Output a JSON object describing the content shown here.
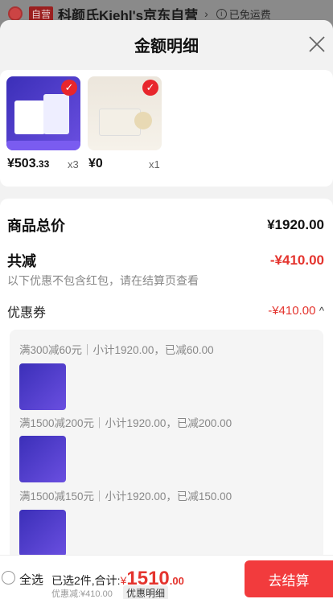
{
  "background_header": {
    "tag": "自营",
    "store_name": "科颜氏Kiehl's京东自营",
    "arrow": "›",
    "shipping": "已免运费",
    "info_icon": "i"
  },
  "sheet": {
    "title": "金额明细",
    "close_icon": "close-icon"
  },
  "products": [
    {
      "price_main": "¥503",
      "price_dec": ".33",
      "qty": "x3"
    },
    {
      "price_main": "¥0",
      "price_dec": "",
      "qty": "x1"
    }
  ],
  "summary": {
    "goods_total_label": "商品总价",
    "goods_total_value": "¥1920.00",
    "reduction_label": "共减",
    "reduction_value": "-¥410.00",
    "note": "以下优惠不包含红包，请在结算页查看",
    "coupon_label": "优惠券",
    "coupon_value": "-¥410.00",
    "coupon_toggle": "^"
  },
  "coupons": [
    {
      "line": "满300减60元｜小计1920.00，已减60.00"
    },
    {
      "line": "满1500减200元｜小计1920.00，已减200.00"
    },
    {
      "line": "满1500减150元｜小计1920.00，已减150.00"
    }
  ],
  "bottom_bar": {
    "select_all": "全选",
    "selected_text": "已选2件,合计:",
    "yen": "¥",
    "total_int": "1510",
    "total_dec": ".00",
    "discount_text": "优惠减:¥410.00",
    "detail_button": "优惠明细",
    "checkout_button": "去结算"
  },
  "colors": {
    "accent_red": "#e4342e",
    "checkout_red": "#f23b3d"
  }
}
